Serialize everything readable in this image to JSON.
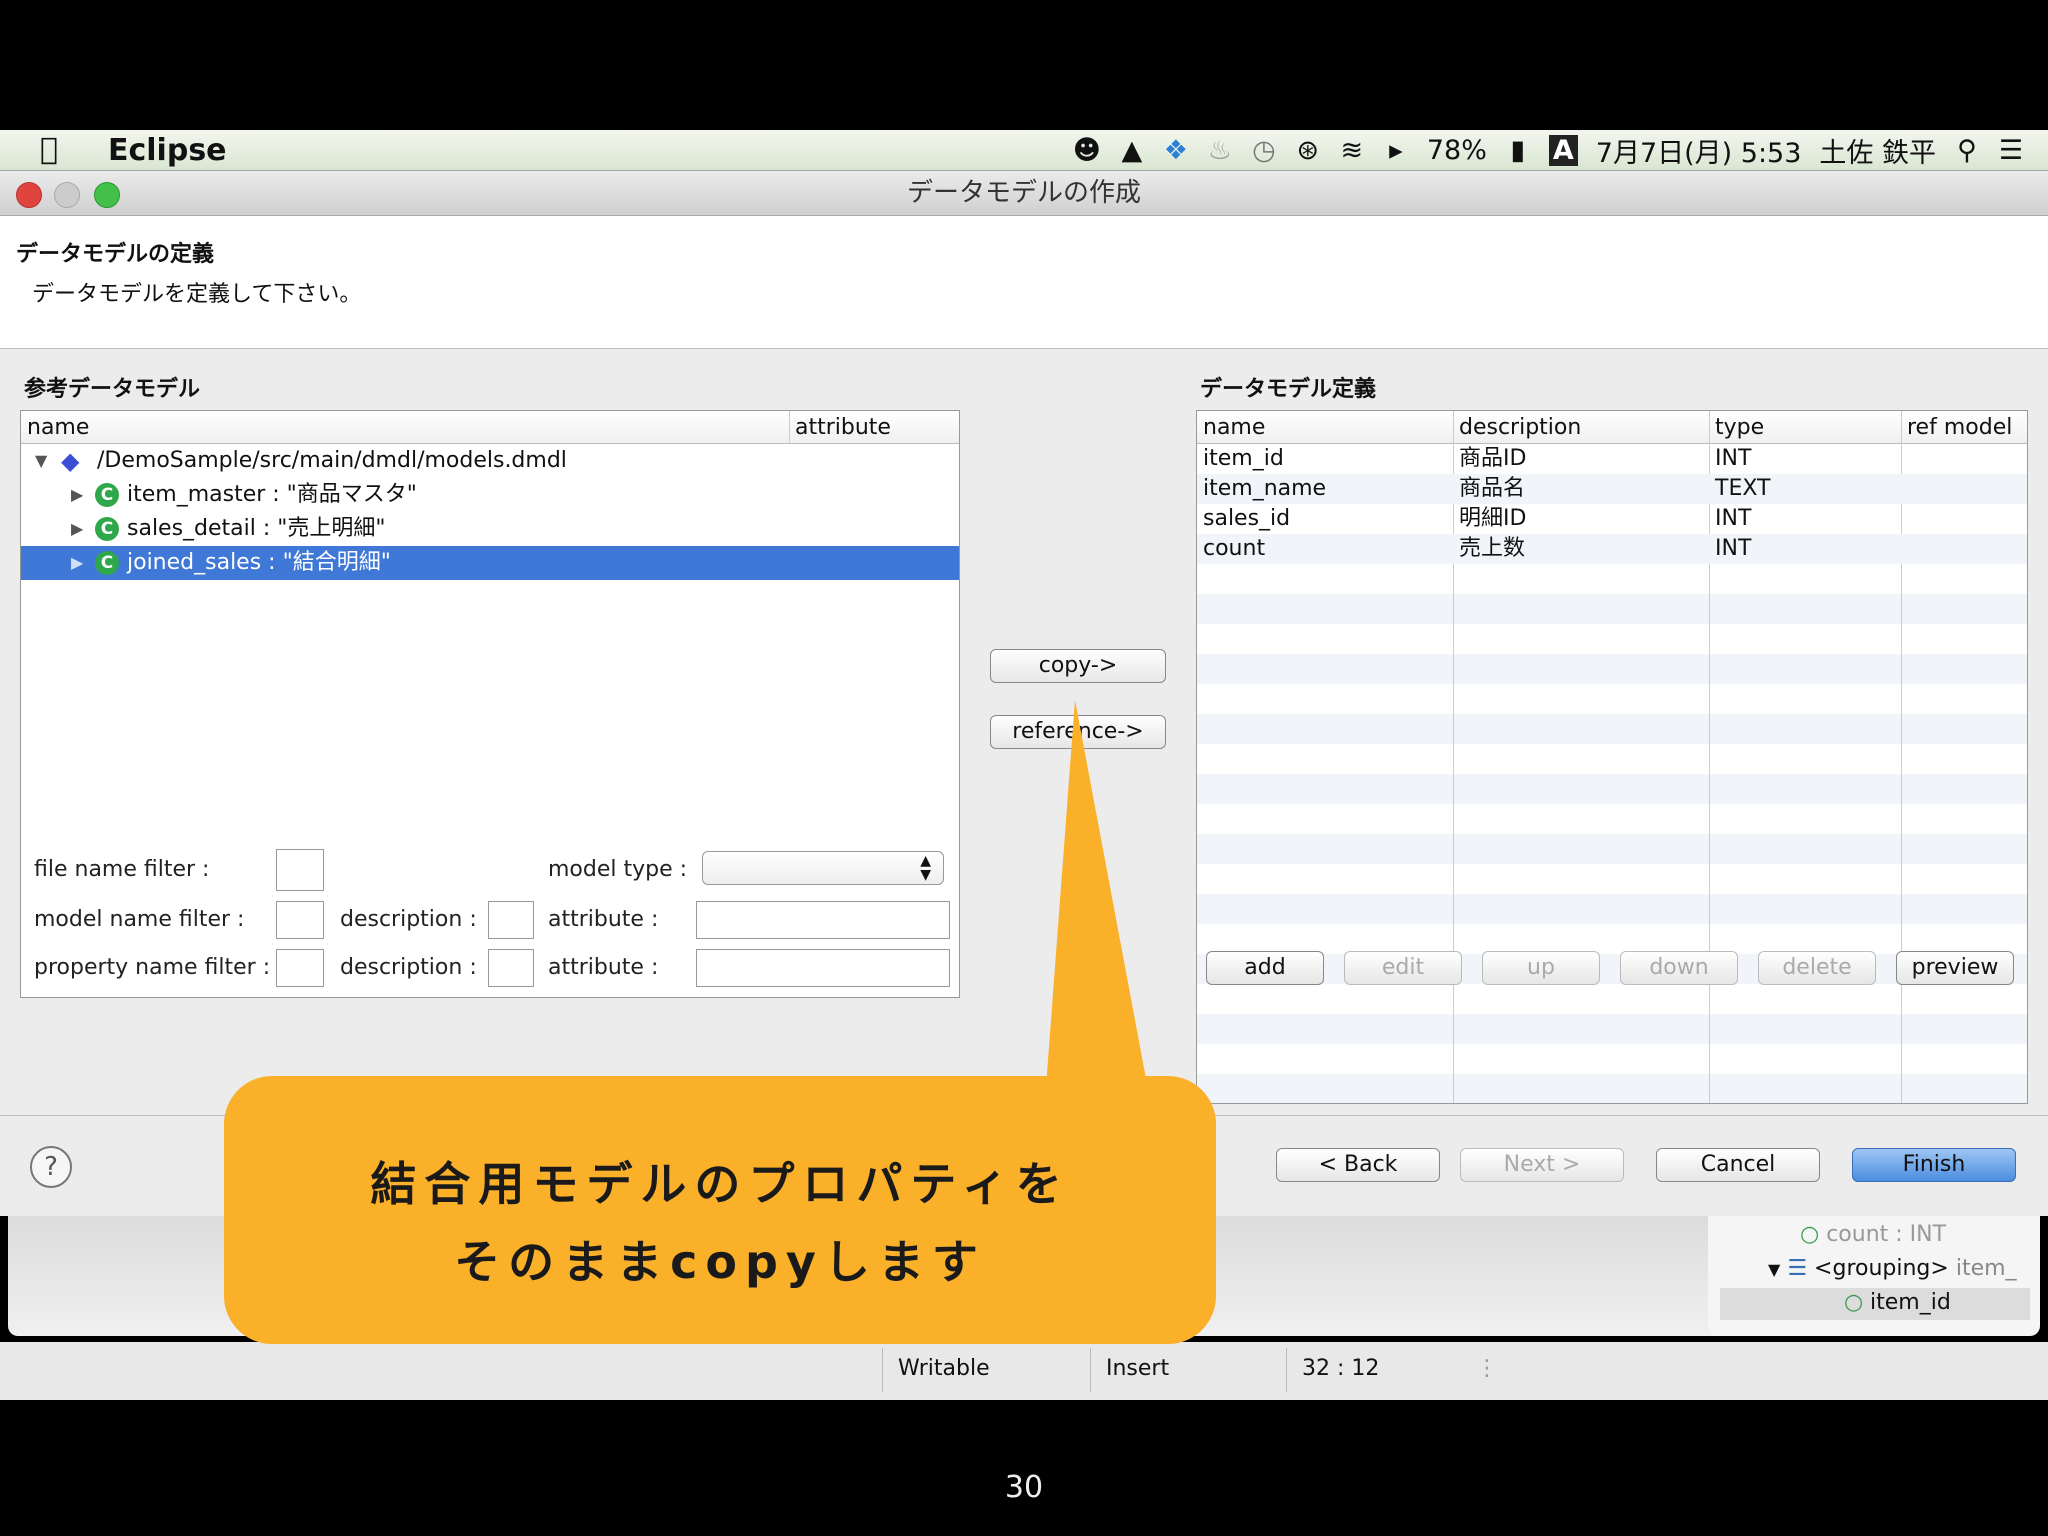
{
  "menubar": {
    "app_name": "Eclipse",
    "battery": "78%",
    "input_source": "A",
    "datetime": "7月7日(月) 5:53",
    "user": "土佐 鉄平"
  },
  "window": {
    "title": "データモデルの作成"
  },
  "header": {
    "title": "データモデルの定義",
    "subtitle": "データモデルを定義して下さい。"
  },
  "left": {
    "label": "参考データモデル",
    "columns": [
      "name",
      "attribute"
    ],
    "tree": [
      {
        "label": "/DemoSample/src/main/dmdl/models.dmdl"
      },
      {
        "label": "item_master : \"商品マスタ\""
      },
      {
        "label": "sales_detail : \"売上明細\""
      },
      {
        "label": "joined_sales : \"結合明細\""
      }
    ]
  },
  "filters": {
    "file_name_filter": "file name filter :",
    "model_type": "model type :",
    "model_name_filter": "model name filter :",
    "property_name_filter": "property name filter :",
    "description": "description :",
    "attribute": "attribute :"
  },
  "middle": {
    "copy": "copy->",
    "reference": "reference->"
  },
  "right": {
    "label": "データモデル定義",
    "columns": [
      "name",
      "description",
      "type",
      "ref model"
    ],
    "rows": [
      {
        "name": "item_id",
        "description": "商品ID",
        "type": "INT"
      },
      {
        "name": "item_name",
        "description": "商品名",
        "type": "TEXT"
      },
      {
        "name": "sales_id",
        "description": "明細ID",
        "type": "INT"
      },
      {
        "name": "count",
        "description": "売上数",
        "type": "INT"
      }
    ],
    "buttons": {
      "add": "add",
      "edit": "edit",
      "up": "up",
      "down": "down",
      "delete": "delete",
      "preview": "preview"
    }
  },
  "footer": {
    "back": "< Back",
    "next": "Next >",
    "cancel": "Cancel",
    "finish": "Finish",
    "help": "?"
  },
  "outline": {
    "item1": "count : INT",
    "item2": "<grouping>",
    "item2_suffix": "item_",
    "item3": "item_id"
  },
  "statusbar": {
    "writable": "Writable",
    "insert": "Insert",
    "position": "32 : 12"
  },
  "callout": {
    "line1": "結合用モデルのプロパティを",
    "line2": "そのままcopyします"
  },
  "slide_number": "30",
  "colors": {
    "callout": "#fbb02a",
    "selection": "#3f78d6",
    "finish": "#4a8de0"
  }
}
